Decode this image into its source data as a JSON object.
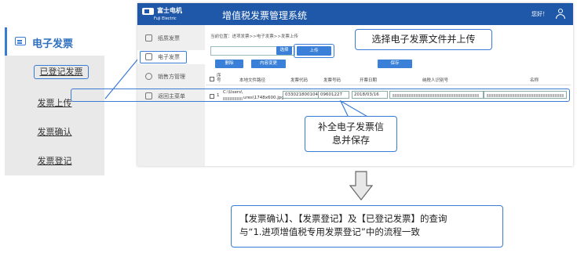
{
  "left_panel": {
    "header": "电子发票",
    "items": [
      "已登记发票",
      "发票上传",
      "发票确认",
      "发票登记"
    ]
  },
  "app": {
    "logo_cn": "富士电机",
    "logo_en": "Fuji Electric",
    "title": "增值税发票管理系统",
    "greeting": "您好！",
    "sidebar": [
      "纸质发票",
      "电子发票",
      "销售方管理",
      "返回主菜单"
    ],
    "breadcrumb": "当前位置：进项发票>>电子发票>>发票上传",
    "buttons": {
      "select": "选择",
      "upload": "上传",
      "delete": "删除",
      "content_change": "内容变更",
      "save": "保存"
    },
    "table": {
      "headers": [
        "序号",
        "本地文件路径",
        "发票代码",
        "发票号码",
        "开票日期",
        "纳税人识别号",
        "名称"
      ],
      "row": {
        "index": "1",
        "path_visible": "C:\\Users\\",
        "path_tail": "ures\\1748x600.jpg",
        "code": "033021800104",
        "number": "09601227",
        "date": "2018/03/16"
      }
    }
  },
  "callouts": {
    "select_file": "选择电子发票文件并上传",
    "fill_info_line1": "补全电子发票信",
    "fill_info_line2": "息并保存"
  },
  "footer_note": {
    "line1": "【发票确认】、【发票登记】及【已登记发票】的查询",
    "line2": "与“1.进项增值税专用发票登记”中的流程一致"
  },
  "colors": {
    "accent": "#3a7bd5",
    "topbar": "#1f58a8",
    "button": "#3a80d8"
  }
}
